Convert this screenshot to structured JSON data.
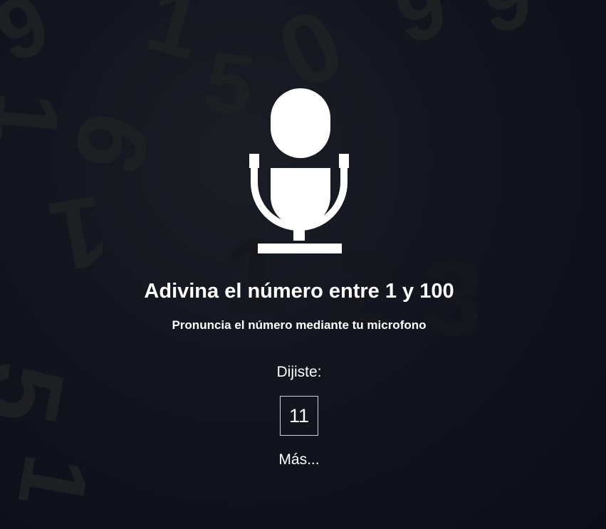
{
  "game": {
    "title": "Adivina el número entre 1 y 100",
    "instruction": "Pronuncia el número mediante tu microfono",
    "said_label": "Dijiste:",
    "said_value": "11",
    "hint": "Más..."
  },
  "icons": {
    "microphone": "microphone-icon"
  },
  "background": {
    "digits": [
      "9",
      "1",
      "5",
      "0",
      "9",
      "9",
      "1",
      "9",
      "1",
      "5",
      "1",
      "2",
      "3",
      "5",
      "1"
    ]
  },
  "colors": {
    "background": "#0d101b",
    "text": "#ffffff",
    "box_border": "#cfd2da",
    "digit_shade": "#1e1f22"
  }
}
